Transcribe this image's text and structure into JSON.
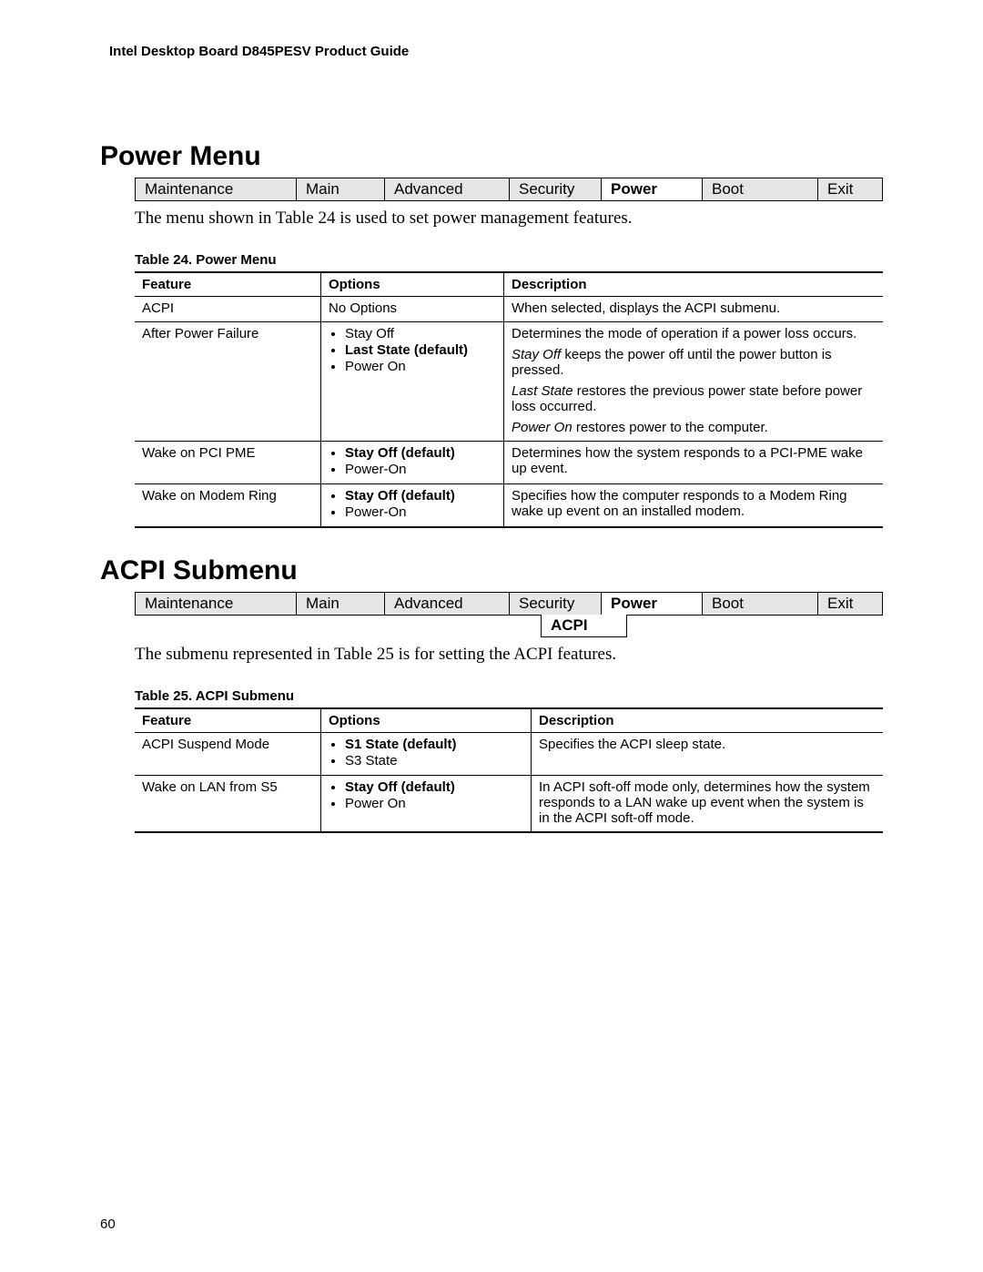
{
  "doc_header": "Intel Desktop Board D845PESV Product Guide",
  "page_number": "60",
  "section1": {
    "heading": "Power Menu",
    "tabs": {
      "maintenance": "Maintenance",
      "main": "Main",
      "advanced": "Advanced",
      "security": "Security",
      "power": "Power",
      "boot": "Boot",
      "exit": "Exit"
    },
    "intro": "The menu shown in Table 24 is used to set power management features.",
    "table_caption": "Table 24.    Power Menu",
    "headers": {
      "feature": "Feature",
      "options": "Options",
      "description": "Description"
    },
    "rows": [
      {
        "feature": "ACPI",
        "options_plain": "No Options",
        "desc": [
          {
            "text": "When selected, displays the ACPI submenu."
          }
        ]
      },
      {
        "feature": "After Power Failure",
        "options": [
          {
            "label": "Stay Off",
            "bold": false
          },
          {
            "label": "Last State (default)",
            "bold": true
          },
          {
            "label": "Power On",
            "bold": false
          }
        ],
        "desc": [
          {
            "text": "Determines the mode of operation if a power loss occurs."
          },
          {
            "lead_italic": "Stay Off",
            "rest": " keeps the power off until the power button is pressed."
          },
          {
            "lead_italic": "Last State",
            "rest": " restores the previous power state before power loss occurred."
          },
          {
            "lead_italic": "Power On",
            "rest": " restores power to the computer."
          }
        ]
      },
      {
        "feature": "Wake on PCI PME",
        "options": [
          {
            "label": "Stay Off (default)",
            "bold": true
          },
          {
            "label": "Power-On",
            "bold": false
          }
        ],
        "desc": [
          {
            "text": "Determines how the system responds to a PCI-PME wake up event."
          }
        ]
      },
      {
        "feature": "Wake on Modem Ring",
        "options": [
          {
            "label": "Stay Off (default)",
            "bold": true
          },
          {
            "label": "Power-On",
            "bold": false
          }
        ],
        "desc": [
          {
            "text": "Specifies how the computer responds to a Modem Ring wake up event on an installed modem."
          }
        ]
      }
    ]
  },
  "section2": {
    "heading": "ACPI Submenu",
    "tabs": {
      "maintenance": "Maintenance",
      "main": "Main",
      "advanced": "Advanced",
      "security": "Security",
      "power": "Power",
      "boot": "Boot",
      "exit": "Exit"
    },
    "submenu_cell": "ACPI",
    "intro": "The submenu represented in Table 25 is for setting the ACPI features.",
    "table_caption": "Table 25.    ACPI Submenu",
    "headers": {
      "feature": "Feature",
      "options": "Options",
      "description": "Description"
    },
    "rows": [
      {
        "feature": "ACPI Suspend Mode",
        "options": [
          {
            "label": "S1 State (default)",
            "bold": true
          },
          {
            "label": "S3 State",
            "bold": false
          }
        ],
        "desc": [
          {
            "text": "Specifies the ACPI sleep state."
          }
        ]
      },
      {
        "feature": "Wake on LAN from S5",
        "options": [
          {
            "label": "Stay Off (default)",
            "bold": true
          },
          {
            "label": "Power On",
            "bold": false
          }
        ],
        "desc": [
          {
            "text": "In ACPI soft-off mode only, determines how the system responds to a LAN wake up event when the system is in the ACPI soft-off mode."
          }
        ]
      }
    ]
  }
}
